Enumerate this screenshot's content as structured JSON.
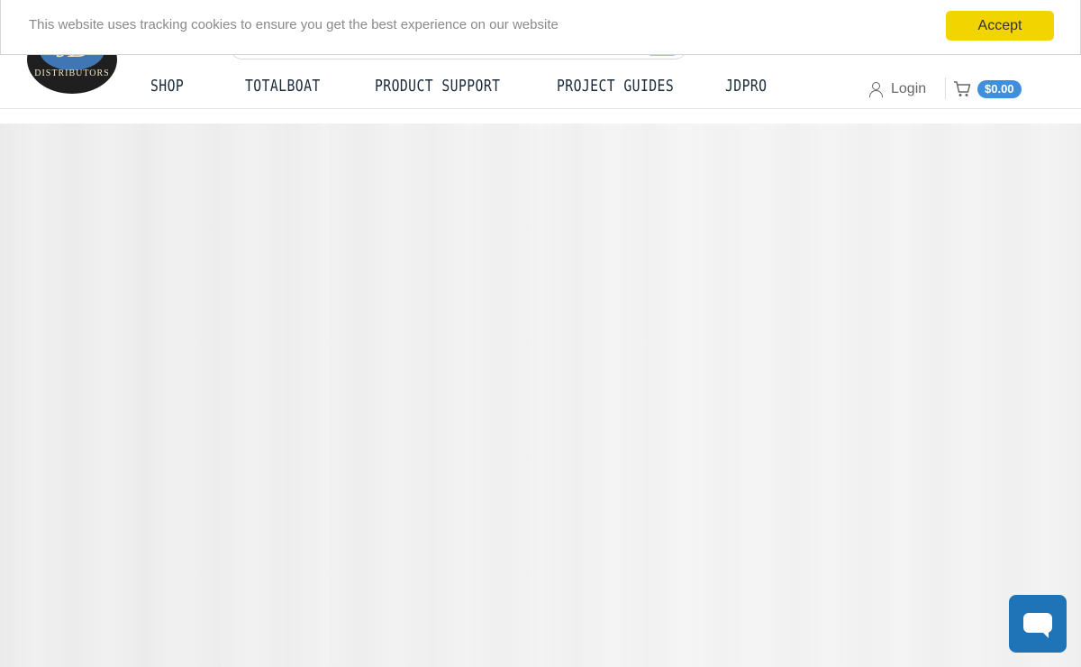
{
  "cookie_banner": {
    "message": "This website uses tracking cookies to ensure you get the best experience on our website",
    "accept_label": "Accept"
  },
  "logo": {
    "letters": "JD",
    "ring_text": "DISTRIBUTORS"
  },
  "nav": {
    "items": [
      {
        "label": "SHOP"
      },
      {
        "label": "TOTALBOAT"
      },
      {
        "label": "PRODUCT SUPPORT"
      },
      {
        "label": "PROJECT GUIDES"
      },
      {
        "label": "JDPRO"
      }
    ]
  },
  "account": {
    "login_label": "Login",
    "cart_total": "$0.00"
  },
  "colors": {
    "accent": "#3f8fdc",
    "accept_button": "#f2d400",
    "chat_button": "#1f73b7"
  }
}
